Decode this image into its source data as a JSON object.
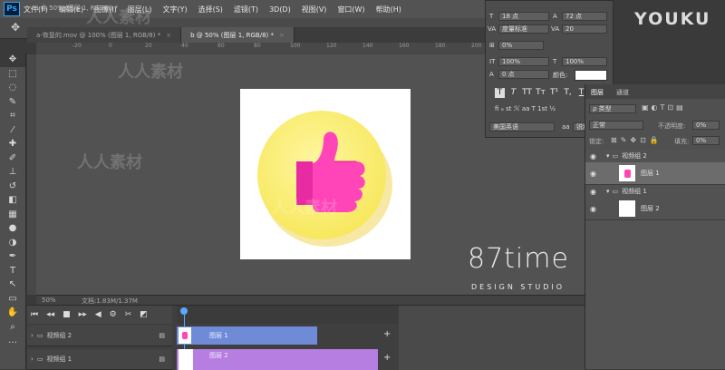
{
  "app": {
    "logo": "Ps",
    "title_mini": "ti @ 50% (图层 1, RGB/8) *"
  },
  "menu": [
    "文件(F)",
    "编辑(E)",
    "图像(I)",
    "图层(L)",
    "文字(Y)",
    "选择(S)",
    "滤镜(T)",
    "3D(D)",
    "视图(V)",
    "窗口(W)",
    "帮助(H)"
  ],
  "tabs": [
    {
      "label": "a-恢复的.mov @ 100% (图层 1, RGB/8) *",
      "active": false
    },
    {
      "label": "b @ 50% (图层 1, RGB/8) *",
      "active": true
    }
  ],
  "ruler_top": [
    "-20",
    "0",
    "20",
    "40",
    "60",
    "80",
    "100",
    "120",
    "140",
    "160",
    "180",
    "200",
    "220",
    "240",
    "260"
  ],
  "status": {
    "zoom": "50%",
    "doc": "文档:1.83M/1.37M"
  },
  "timeline": {
    "rows": [
      {
        "label": "视频组 2",
        "clip": "图层 1"
      },
      {
        "label": "视频组 1",
        "clip": "图层 2"
      }
    ]
  },
  "character_panel": {
    "font_size": "18 点",
    "leading": "72 点",
    "kerning": "度量标准",
    "tracking": "20",
    "scale_pct": "0%",
    "vscale": "100%",
    "hscale": "100%",
    "baseline": "0 点",
    "color_label": "颜色:",
    "language": "美国英语",
    "aa": "锐利",
    "styles": [
      "T",
      "T",
      "TT",
      "Tт",
      "T¹",
      "T,",
      "T"
    ]
  },
  "layers_panel": {
    "tabs": [
      "图层",
      "通道"
    ],
    "filter_label": "ρ 类型",
    "blend": "正常",
    "opacity_label": "不透明度:",
    "opacity": "0%",
    "lock_label": "锁定:",
    "fill_label": "填充:",
    "fill": "0%",
    "layers": [
      {
        "name": "视频组 2",
        "type": "group",
        "selected": false
      },
      {
        "name": "图层 1",
        "type": "layer",
        "selected": true
      },
      {
        "name": "视频组 1",
        "type": "group",
        "selected": false
      },
      {
        "name": "图层 2",
        "type": "layer",
        "selected": false
      }
    ]
  },
  "watermarks": {
    "youku": "YOUKU",
    "brand": "87time",
    "brand_sub": "DESIGN STUDIO",
    "cn": "人人素材"
  },
  "colors": {
    "circle": "#fbf18a",
    "thumb": "#ff3fb8",
    "clip1": "#6f8bd8",
    "clip2": "#b57ee0"
  }
}
